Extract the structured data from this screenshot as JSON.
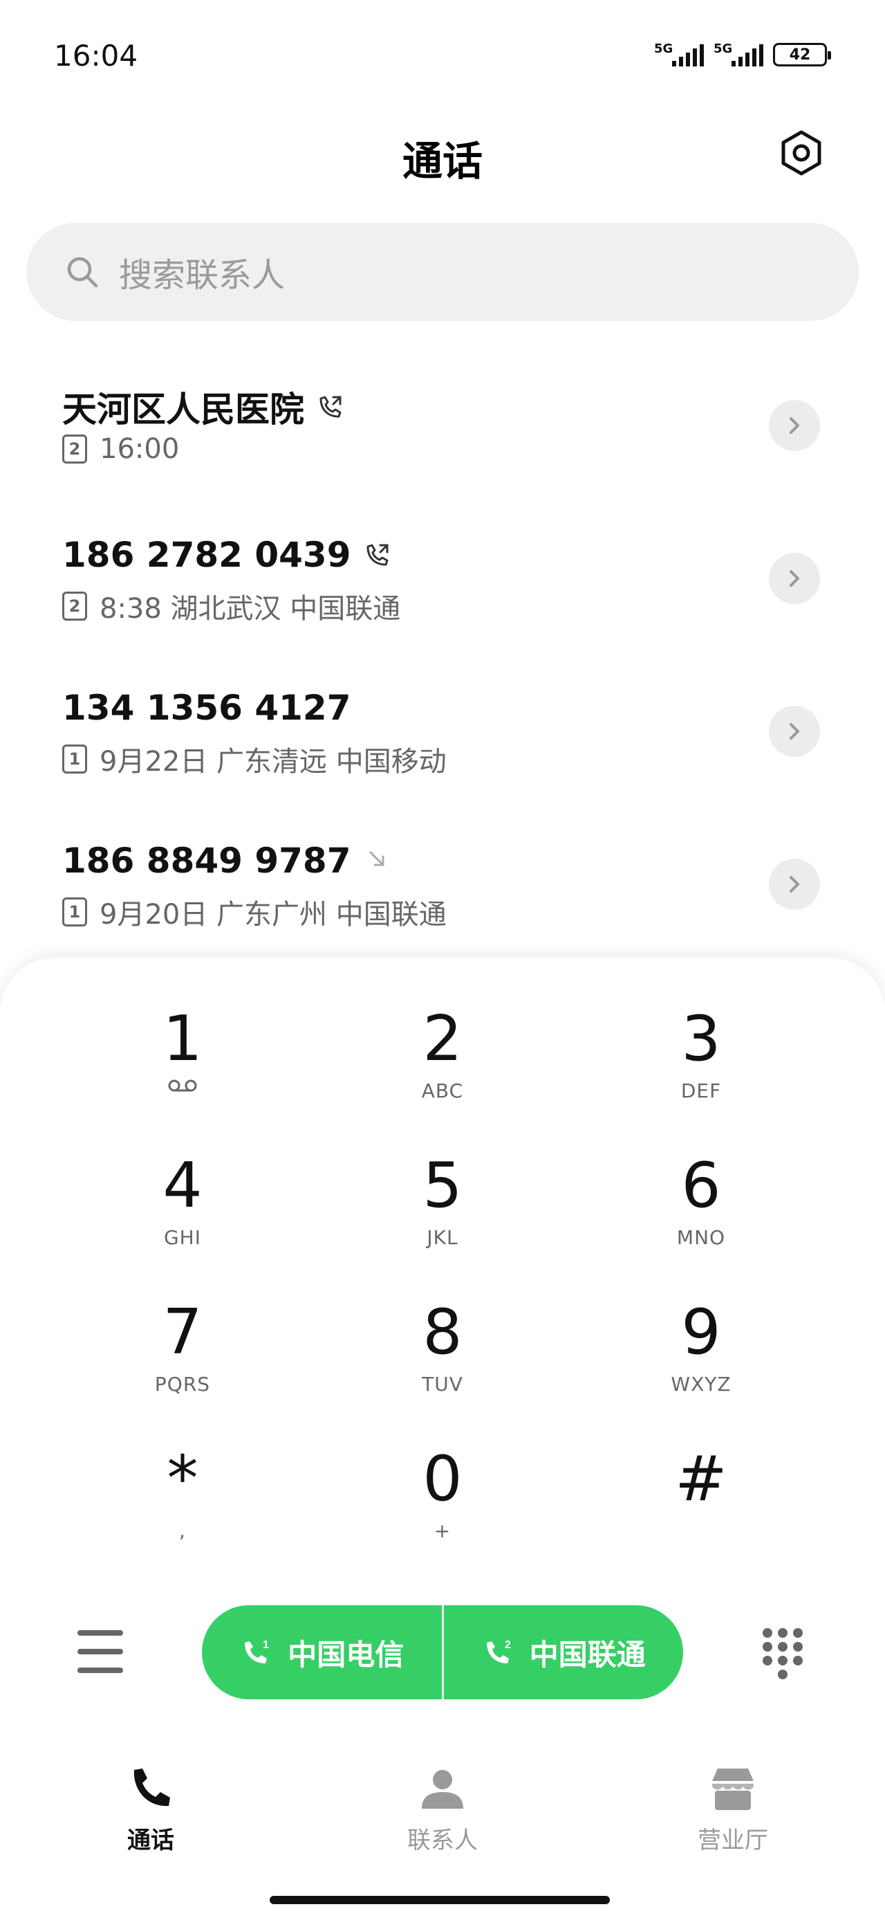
{
  "status_bar": {
    "time": "16:04",
    "sim1_network": "5G",
    "sim2_network": "5G",
    "battery": "42"
  },
  "header": {
    "title": "通话",
    "settings_icon": "gear-icon"
  },
  "search": {
    "placeholder": "搜索联系人"
  },
  "calls": [
    {
      "name": "天河区人民医院",
      "type_icon": "outgoing-call-icon",
      "sim": "2",
      "detail": "16:00"
    },
    {
      "name": "186 2782 0439",
      "type_icon": "outgoing-call-icon",
      "sim": "2",
      "detail": "8:38 湖北武汉 中国联通"
    },
    {
      "name": "134 1356 4127",
      "type_icon": "",
      "sim": "1",
      "detail": "9月22日 广东清远 中国移动"
    },
    {
      "name": "186 8849 9787",
      "type_icon": "missed-call-icon",
      "sim": "1",
      "detail": "9月20日 广东广州 中国联通"
    }
  ],
  "dialpad": {
    "keys": [
      {
        "digit": "1",
        "letters": ""
      },
      {
        "digit": "2",
        "letters": "ABC"
      },
      {
        "digit": "3",
        "letters": "DEF"
      },
      {
        "digit": "4",
        "letters": "GHI"
      },
      {
        "digit": "5",
        "letters": "JKL"
      },
      {
        "digit": "6",
        "letters": "MNO"
      },
      {
        "digit": "7",
        "letters": "PQRS"
      },
      {
        "digit": "8",
        "letters": "TUV"
      },
      {
        "digit": "9",
        "letters": "WXYZ"
      },
      {
        "digit": "*",
        "letters": ","
      },
      {
        "digit": "0",
        "letters": "+"
      },
      {
        "digit": "#",
        "letters": ""
      }
    ]
  },
  "call_buttons": {
    "sim1": {
      "sim": "1",
      "label": "中国电信"
    },
    "sim2": {
      "sim": "2",
      "label": "中国联通"
    },
    "color": "#36cf66"
  },
  "bottom_nav": [
    {
      "label": "通话",
      "icon": "phone-icon",
      "active": true
    },
    {
      "label": "联系人",
      "icon": "person-icon",
      "active": false
    },
    {
      "label": "营业厅",
      "icon": "store-icon",
      "active": false
    }
  ]
}
